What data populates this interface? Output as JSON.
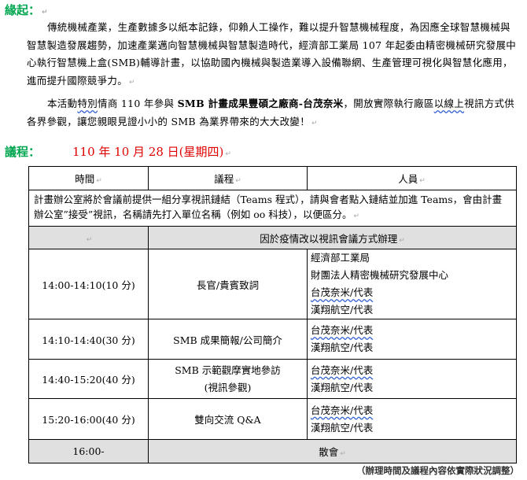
{
  "intro": {
    "title": "緣起",
    "colon": "：",
    "p1": "傳統機械產業，生產數據多以紙本記錄，仰賴人工操作，難以提升智慧機械程度，為因應全球智慧機械與智慧製造發展趨勢，加速產業邁向智慧機械與智慧製造時代，經濟部工業局 107 年起委由精密機械研究發展中心執行智慧機上盒(SMB)輔導計畫，以協助國內機械與製造業導入設備聯網、生產管理可視化與智慧化應用，進而提升國際競爭力。",
    "p2_a": "本活動",
    "p2_b": "特別",
    "p2_c": "情商 110 年參與 ",
    "p2_bold": "SMB 計畫成果豐碩之廠商-台茂奈米",
    "p2_d": "，開放實際執行廠區",
    "p2_e": "以線上",
    "p2_f": "視訊方式供各界參觀，讓您親眼見證小小的 SMB 為業界帶來的大大改變！"
  },
  "agenda": {
    "title": "議程",
    "colon": "：",
    "date": "110 年 10 月 28 日(星期四)",
    "headers": {
      "time": "時間",
      "topic": "議程",
      "people": "人員"
    },
    "note": "計畫辦公室將於會議前提供一組分享視訊鏈結（Teams 程式），請與會者點入鏈結並加進 Teams，會由計畫辦公室”接受”視訊，名稱請先打入單位名稱（例如 oo 科技），以便區分。",
    "notice": "因於疫情改以視訊會議方式辦理",
    "rows": [
      {
        "time": "14:00-14:10(10 分)",
        "topic": "長官/貴賓致詞",
        "people": [
          "經濟部工業局",
          "財團法人精密機械研究發展中心",
          "台茂奈米/代表",
          "漢翔航空/代表"
        ]
      },
      {
        "time": "14:10-14:40(30 分)",
        "topic": "SMB 成果簡報/公司簡介",
        "people": [
          "台茂奈米/代表",
          "漢翔航空/代表"
        ]
      },
      {
        "time": "14:40-15:20(40 分)",
        "topic": "SMB 示範觀摩實地參訪",
        "topic2": "(視訊參觀)",
        "people": [
          "台茂奈米/代表",
          "漢翔航空/代表"
        ]
      },
      {
        "time": "15:20-16:00(40 分)",
        "topic": "雙向交流 Q&A",
        "people": [
          "台茂奈米/代表",
          "漢翔航空/代表"
        ]
      }
    ],
    "end_time": "16:00-",
    "end_label": "散會"
  },
  "footer": "（辦理時間及議程內容依實際狀況調整）"
}
